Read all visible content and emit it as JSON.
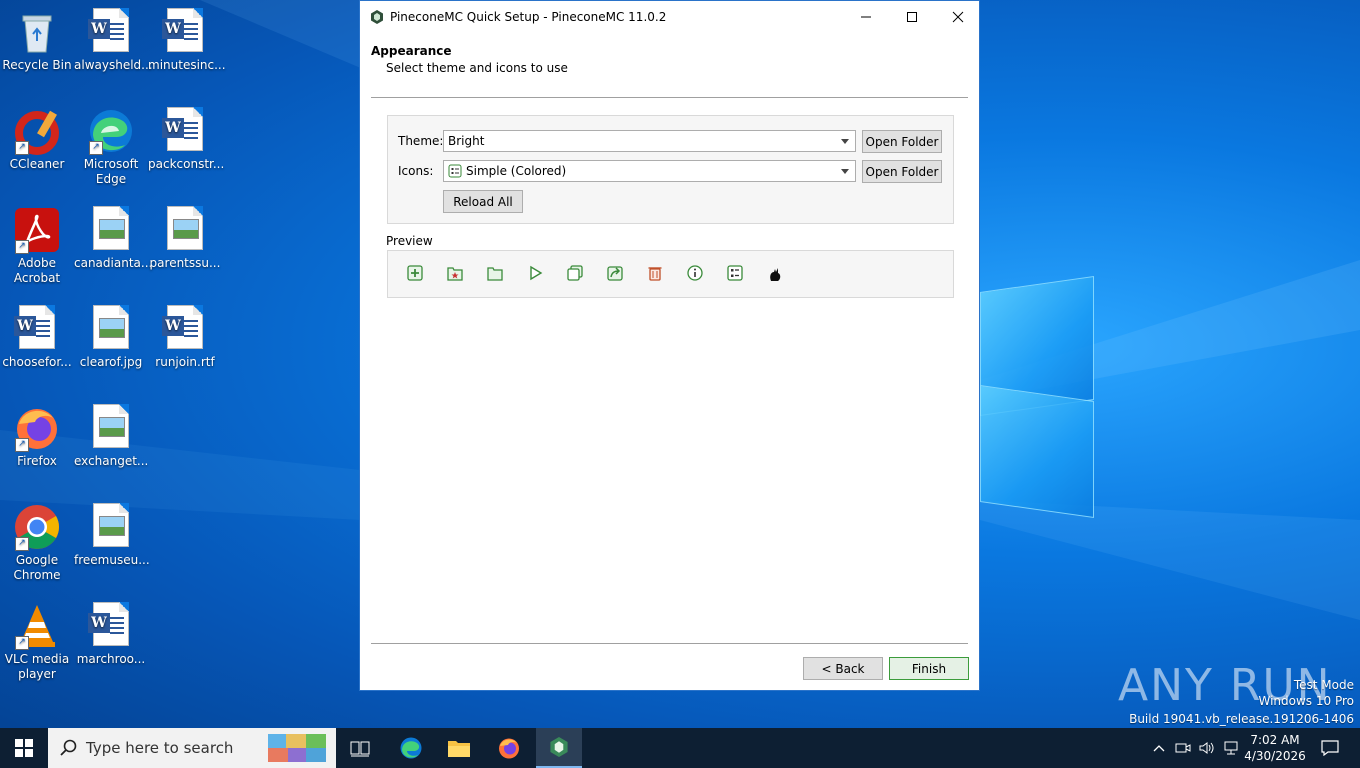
{
  "desktop": {
    "icons": [
      {
        "label": "Recycle Bin",
        "icon": "recycle-bin-icon"
      },
      {
        "label": "alwaysheld...",
        "icon": "word-doc-icon"
      },
      {
        "label": "minutesinc...",
        "icon": "word-doc-icon"
      },
      {
        "label": "CCleaner",
        "icon": "ccleaner-icon"
      },
      {
        "label": "Microsoft Edge",
        "icon": "edge-icon"
      },
      {
        "label": "packconstr...",
        "icon": "word-doc-icon"
      },
      {
        "label": "Adobe Acrobat",
        "icon": "acrobat-icon"
      },
      {
        "label": "canadianta...",
        "icon": "image-file-icon"
      },
      {
        "label": "parentssu...",
        "icon": "image-file-icon"
      },
      {
        "label": "choosefor...",
        "icon": "word-doc-icon"
      },
      {
        "label": "clearof.jpg",
        "icon": "image-file-icon"
      },
      {
        "label": "runjoin.rtf",
        "icon": "word-doc-icon"
      },
      {
        "label": "Firefox",
        "icon": "firefox-icon"
      },
      {
        "label": "exchanget...",
        "icon": "image-file-icon"
      },
      {
        "label": "Google Chrome",
        "icon": "chrome-icon"
      },
      {
        "label": "freemuseu...",
        "icon": "image-file-icon"
      },
      {
        "label": "VLC media player",
        "icon": "vlc-icon"
      },
      {
        "label": "marchroo...",
        "icon": "word-doc-icon"
      }
    ]
  },
  "window": {
    "title": "PineconeMC Quick Setup - PineconeMC 11.0.2",
    "header_title": "Appearance",
    "header_subtitle": "Select theme and icons to use",
    "theme_label": "Theme:",
    "theme_value": "Bright",
    "icons_label": "Icons:",
    "icons_value": "Simple (Colored)",
    "open_folder_label": "Open Folder",
    "reload_all_label": "Reload All",
    "preview_label": "Preview",
    "preview_icons": [
      "new-instance-icon",
      "favorite-icon",
      "folder-icon",
      "launch-icon",
      "copy-instance-icon",
      "export-icon",
      "delete-icon",
      "about-icon",
      "settings-icon",
      "cat-icon"
    ],
    "back_label": "< Back",
    "finish_label": "Finish"
  },
  "watermark": {
    "brand": "ANY RUN",
    "line1": "Test Mode",
    "line2": "Windows 10 Pro",
    "line3": "Build 19041.vb_release.191206-1406"
  },
  "taskbar": {
    "search_placeholder": "Type here to search",
    "time": "7:02 AM",
    "date": "4/30/2026"
  },
  "colors": {
    "accent": "#2a73c9",
    "default_button_border": "#3c9c3c",
    "taskbar": "#0d1f33"
  }
}
